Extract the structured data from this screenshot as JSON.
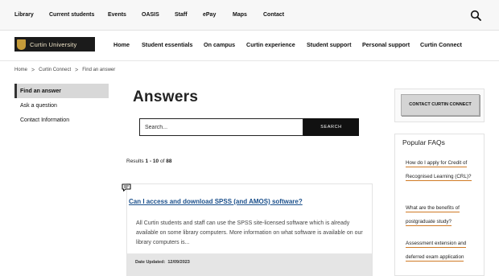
{
  "utility_nav": {
    "items": [
      {
        "label": "Library"
      },
      {
        "label": "Current students"
      },
      {
        "label": "Events"
      },
      {
        "label": "OASIS"
      },
      {
        "label": "Staff"
      },
      {
        "label": "ePay"
      },
      {
        "label": "Maps"
      },
      {
        "label": "Contact"
      }
    ],
    "search_icon": "search-icon"
  },
  "logo": {
    "text": "Curtin University"
  },
  "main_nav": {
    "items": [
      {
        "label": "Home"
      },
      {
        "label": "Student essentials"
      },
      {
        "label": "On campus"
      },
      {
        "label": "Curtin experience"
      },
      {
        "label": "Student support"
      },
      {
        "label": "Personal support"
      },
      {
        "label": "Curtin Connect"
      }
    ]
  },
  "breadcrumb": {
    "items": [
      "Home",
      "Curtin Connect",
      "Find an answer"
    ],
    "separator": ">"
  },
  "sidebar": {
    "items": [
      {
        "label": "Find an answer",
        "active": true
      },
      {
        "label": "Ask a question"
      },
      {
        "label": "Contact Information"
      }
    ]
  },
  "page_title": "Answers",
  "search": {
    "placeholder": "Search...",
    "button_label": "SEARCH"
  },
  "results": {
    "prefix": "Results",
    "from": "1",
    "dash": "-",
    "to": "10",
    "of_label": "of",
    "total": "88"
  },
  "result_items": [
    {
      "icon": "chat-icon",
      "title": "Can I access and download SPSS (and AMOS) software?",
      "excerpt": "All Curtin students and staff can use the SPSS site-licensed software which is already available on some library computers. More information on what software is available on our library computers is...",
      "date_label": "Date Updated:",
      "date": "12/09/2023"
    }
  ],
  "contact": {
    "button_label": "CONTACT CURTIN CONNECT"
  },
  "faqs": {
    "title": "Popular FAQs",
    "items": [
      {
        "label": "How do I apply for Credit of Recognised Learning (CRL)?"
      },
      {
        "label": "What are the benefits of postgraduate study?"
      },
      {
        "label": "Assessment extension and deferred exam application"
      }
    ]
  },
  "colors": {
    "link": "#1a4f8b",
    "faq_underline": "#d07a25",
    "search_button": "#111111",
    "sidebar_active": "#d8d8d8"
  }
}
